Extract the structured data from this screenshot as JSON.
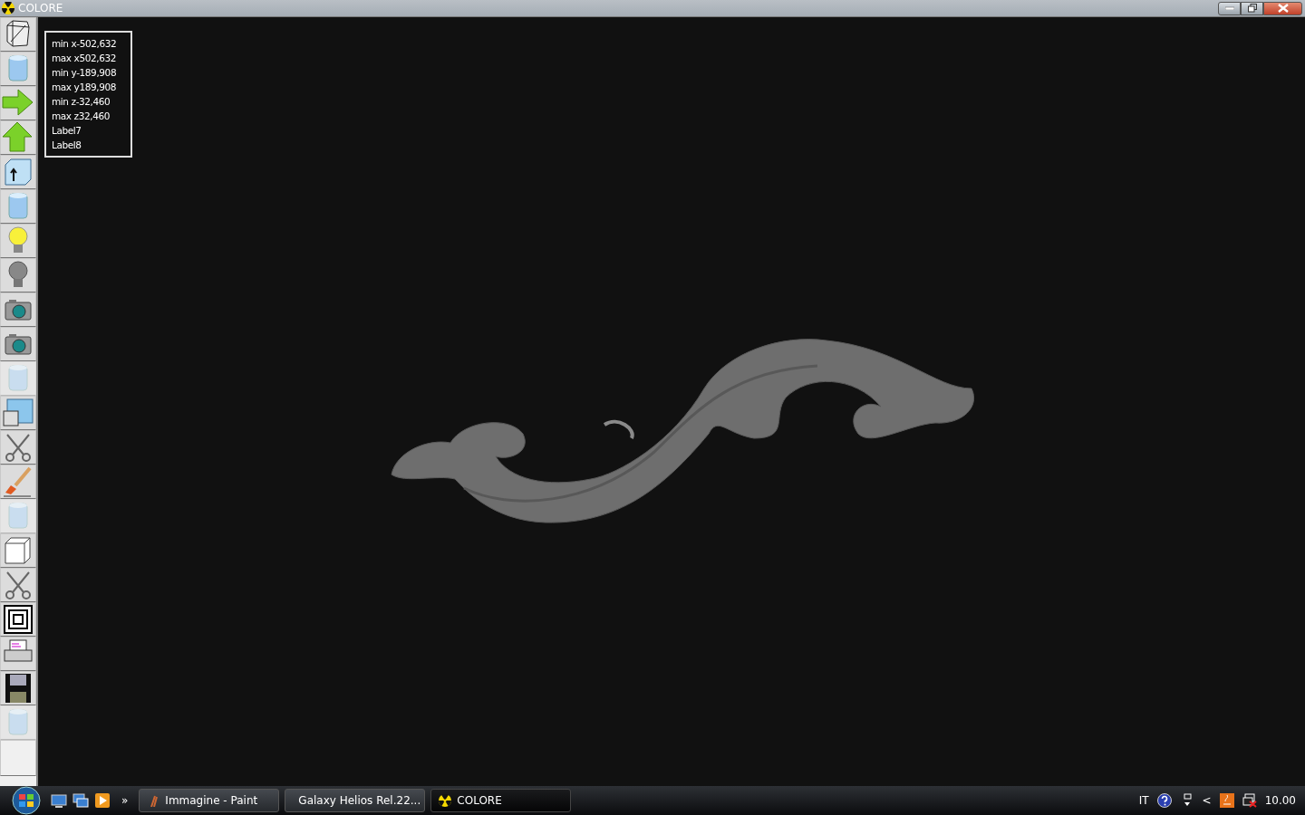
{
  "window": {
    "title": "COLORE"
  },
  "toolbar": [
    {
      "kind": "wireframe",
      "disabled": false
    },
    {
      "kind": "cylinder",
      "disabled": false
    },
    {
      "kind": "arrow-right",
      "disabled": false
    },
    {
      "kind": "arrow-up",
      "disabled": false
    },
    {
      "kind": "box-arrow",
      "disabled": false
    },
    {
      "kind": "cylinder",
      "disabled": false
    },
    {
      "kind": "bulb-on",
      "disabled": false
    },
    {
      "kind": "bulb-off",
      "disabled": false
    },
    {
      "kind": "camera",
      "disabled": false
    },
    {
      "kind": "camera",
      "disabled": false
    },
    {
      "kind": "cylinder",
      "disabled": true
    },
    {
      "kind": "windows",
      "disabled": false
    },
    {
      "kind": "scissors",
      "disabled": false
    },
    {
      "kind": "brush",
      "disabled": false
    },
    {
      "kind": "cylinder",
      "disabled": true
    },
    {
      "kind": "cube",
      "disabled": false
    },
    {
      "kind": "scissors",
      "disabled": false
    },
    {
      "kind": "squares",
      "disabled": false
    },
    {
      "kind": "printer",
      "disabled": false
    },
    {
      "kind": "floppy",
      "disabled": false
    },
    {
      "kind": "cylinder",
      "disabled": true
    },
    {
      "kind": "blank",
      "disabled": false
    }
  ],
  "info_labels": [
    "min x-502,632",
    "max x502,632",
    "min y-189,908",
    "max y189,908",
    "min z-32,460",
    "max z32,460",
    "Label7",
    "Label8"
  ],
  "taskbar": {
    "quick_launch": [
      {
        "kind": "desktop"
      },
      {
        "kind": "windows"
      },
      {
        "kind": "media"
      }
    ],
    "more": "»",
    "tasks": [
      {
        "label": "Immagine - Paint",
        "kind": "paint",
        "selected": false
      },
      {
        "label": "Galaxy Helios  Rel.22...",
        "kind": "app",
        "selected": false
      },
      {
        "label": "COLORE",
        "kind": "radiation",
        "selected": true
      }
    ],
    "tray": {
      "language": "IT",
      "chevron": "<",
      "clock": "10.00"
    }
  }
}
